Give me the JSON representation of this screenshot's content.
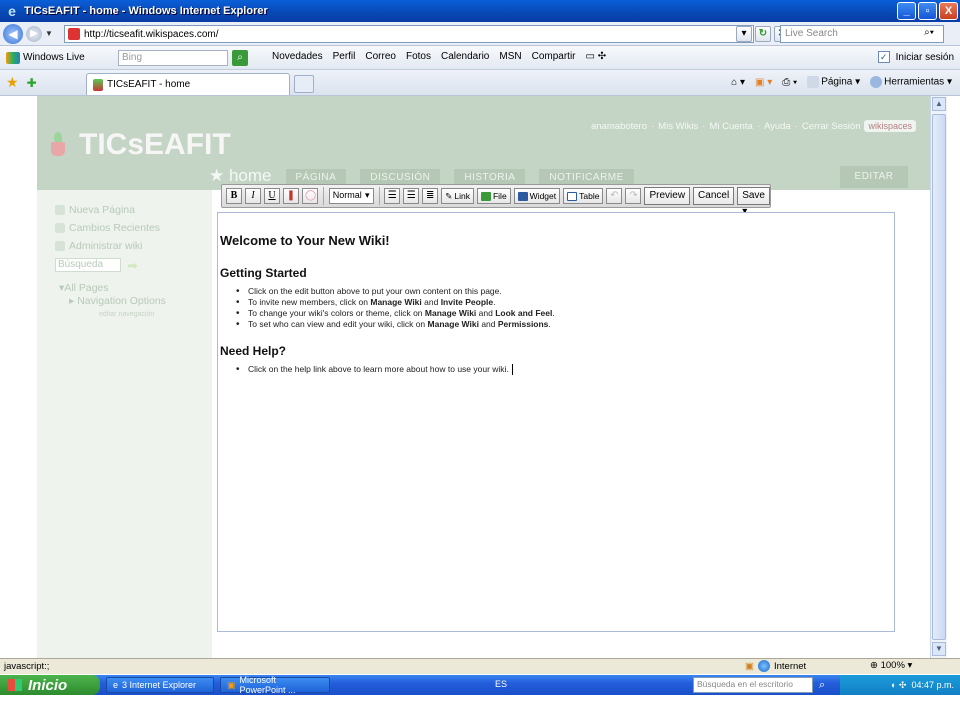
{
  "window": {
    "title": "TICsEAFIT - home - Windows Internet Explorer",
    "buttons": [
      "_",
      "▫",
      "X"
    ]
  },
  "addressbar": {
    "url": "http://ticseafit.wikispaces.com/",
    "search_placeholder": "Live Search"
  },
  "livebar": {
    "brand": "Windows Live",
    "search_placeholder": "Bing",
    "links": [
      "Novedades",
      "Perfil",
      "Correo",
      "Fotos",
      "Calendario",
      "MSN",
      "Compartir"
    ],
    "signin": "Iniciar sesión"
  },
  "tabs": {
    "active_title": "TICsEAFIT - home",
    "commands": [
      "Página",
      "Herramientas"
    ]
  },
  "wiki": {
    "site_name": "TICsEAFIT",
    "userlinks": [
      "anamabotero",
      "Mis Wikis",
      "Mi Cuenta",
      "Ayuda",
      "Cerrar Sesión"
    ],
    "wikispaces_badge": "wikispaces",
    "page_name": "home",
    "page_tabs": [
      "PÁGINA",
      "DISCUSIÓN",
      "HISTORIA",
      "NOTIFICARME"
    ],
    "edit_tab": "EDITAR",
    "sidebar": {
      "items": [
        "Nueva Página",
        "Cambios Recientes",
        "Administrar wiki"
      ],
      "search_value": "Búsqueda",
      "all_pages": "All Pages",
      "nav_options": "Navigation Options",
      "edit_nav": "editar navegación"
    }
  },
  "editor": {
    "toolbar": {
      "bold": "B",
      "italic": "I",
      "underline": "U",
      "format": "Normal",
      "link": "Link",
      "file": "File",
      "widget": "Widget",
      "table": "Table",
      "preview": "Preview",
      "cancel": "Cancel",
      "save": "Save"
    },
    "content": {
      "heading": "Welcome to Your New Wiki!",
      "section1_title": "Getting Started",
      "section1_items": [
        [
          "Click on the edit button above to put your own content on this page."
        ],
        [
          "To invite new members, click on ",
          "Manage Wiki",
          " and ",
          "Invite People",
          "."
        ],
        [
          "To change your wiki's colors or theme, click on ",
          "Manage Wiki",
          " and ",
          "Look and Feel",
          "."
        ],
        [
          "To set who can view and edit your wiki, click on ",
          "Manage Wiki",
          " and ",
          "Permissions",
          "."
        ]
      ],
      "section2_title": "Need Help?",
      "section2_items": [
        [
          "Click on the help link above to learn more about how to use your wiki."
        ]
      ]
    }
  },
  "statusbar": {
    "message": "javascript:;",
    "zone": "Internet",
    "zoom": "100%"
  },
  "taskbar": {
    "start": "Inicio",
    "tasks": [
      "3 Internet Explorer",
      "Microsoft PowerPoint ..."
    ],
    "language": "ES",
    "desktop_search_placeholder": "Búsqueda en el escritorio",
    "time": "04:47 p.m."
  }
}
